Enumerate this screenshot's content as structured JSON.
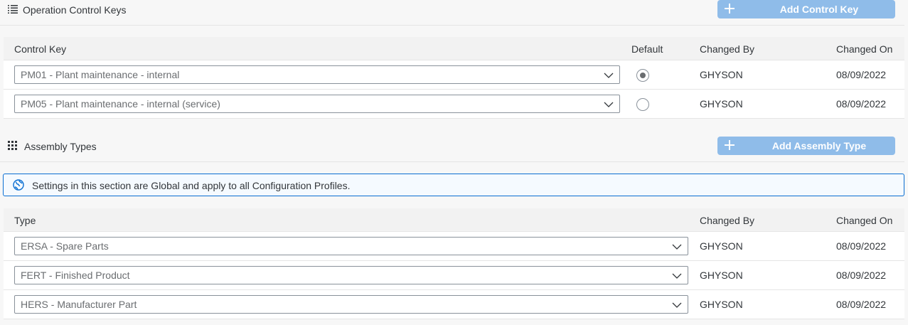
{
  "control_keys": {
    "title": "Operation Control Keys",
    "add_label": "Add Control Key",
    "columns": {
      "key": "Control Key",
      "default": "Default",
      "changed_by": "Changed By",
      "changed_on": "Changed On"
    },
    "rows": [
      {
        "key": "PM01 - Plant maintenance - internal",
        "default": true,
        "changed_by": "GHYSON",
        "changed_on": "08/09/2022"
      },
      {
        "key": "PM05 - Plant maintenance - internal (service)",
        "default": false,
        "changed_by": "GHYSON",
        "changed_on": "08/09/2022"
      }
    ]
  },
  "assembly_types": {
    "title": "Assembly Types",
    "add_label": "Add Assembly Type",
    "info": "Settings in this section are Global and apply to all Configuration Profiles.",
    "columns": {
      "type": "Type",
      "changed_by": "Changed By",
      "changed_on": "Changed On"
    },
    "rows": [
      {
        "type": "ERSA - Spare Parts",
        "changed_by": "GHYSON",
        "changed_on": "08/09/2022"
      },
      {
        "type": "FERT - Finished Product",
        "changed_by": "GHYSON",
        "changed_on": "08/09/2022"
      },
      {
        "type": "HERS - Manufacturer Part",
        "changed_by": "GHYSON",
        "changed_on": "08/09/2022"
      }
    ]
  },
  "colors": {
    "accent": "#0a6ed1",
    "button": "#8fbce9"
  }
}
